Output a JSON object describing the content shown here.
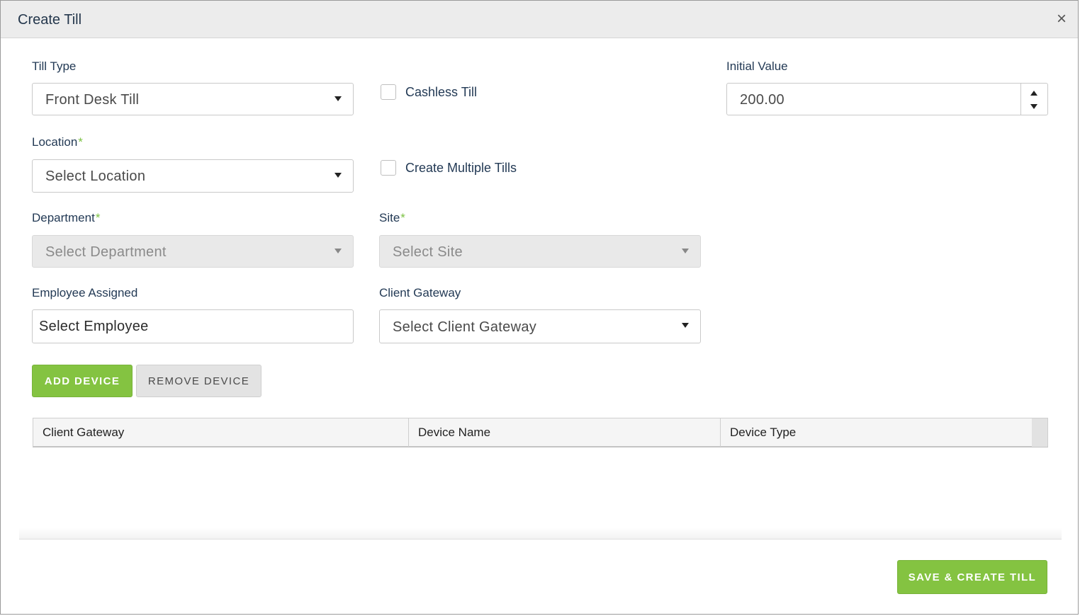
{
  "modal": {
    "title": "Create Till",
    "close": "×"
  },
  "form": {
    "till_type": {
      "label": "Till Type",
      "value": "Front Desk Till"
    },
    "cashless_till": {
      "label": "Cashless Till",
      "checked": false
    },
    "initial_value": {
      "label": "Initial Value",
      "value": "200.00"
    },
    "location": {
      "label": "Location",
      "required": "*",
      "placeholder": "Select Location"
    },
    "create_multiple": {
      "label": "Create Multiple Tills",
      "checked": false
    },
    "department": {
      "label": "Department",
      "required": "*",
      "placeholder": "Select Department"
    },
    "site": {
      "label": "Site",
      "required": "*",
      "placeholder": "Select Site"
    },
    "employee": {
      "label": "Employee Assigned",
      "placeholder": "Select Employee"
    },
    "client_gateway": {
      "label": "Client Gateway",
      "placeholder": "Select Client Gateway"
    }
  },
  "buttons": {
    "add_device": "ADD DEVICE",
    "remove_device": "REMOVE DEVICE",
    "save_create": "SAVE & CREATE TILL"
  },
  "grid": {
    "columns": [
      "Client Gateway",
      "Device Name",
      "Device Type"
    ]
  },
  "colors": {
    "accent_green": "#84c341",
    "required_marker": "#7cc243",
    "label_text": "#233a55"
  }
}
